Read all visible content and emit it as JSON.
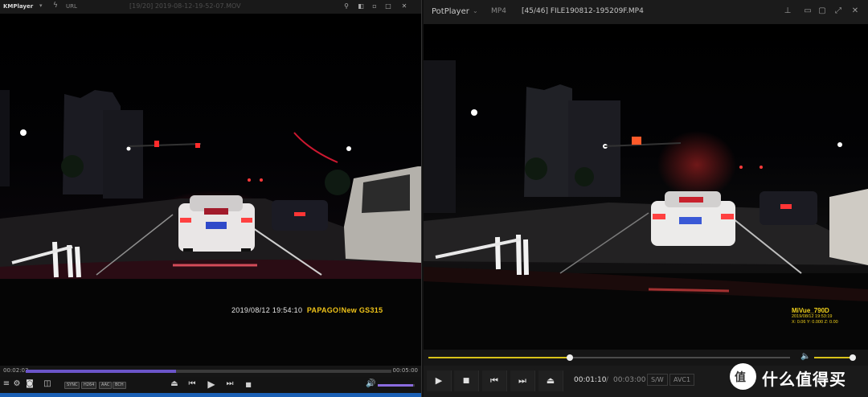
{
  "kmplayer": {
    "app_name": "KMPlayer",
    "url_label": "URL",
    "window_title": "[19/20] 2019-08-12-19-52-07.MOV",
    "osd_timestamp": "2019/08/12 19:54:10",
    "osd_brand": "PAPAGO!New GS315",
    "time_current": "00:02:03",
    "time_total": "00:05:00",
    "progress": 0.41,
    "volume": 0.95,
    "tags": [
      "SYNC",
      "H264",
      "AAC",
      "BCH"
    ],
    "icons": {
      "dropdown": "▾",
      "bolt": "ϟ",
      "pin": "⚲",
      "minimize": "▫",
      "maximize": "□",
      "close": "✕",
      "menu": "≡",
      "settings": "⚙",
      "eject": "⏏",
      "prev": "⏮",
      "play": "▶",
      "next": "⏭",
      "stop": "■",
      "volume": "🔊"
    }
  },
  "potplayer": {
    "app_name": "PotPlayer",
    "format": "MP4",
    "window_title": "[45/46] FILE190812-195209F.MP4",
    "osd_brand": "MiVue_790D",
    "osd_timestamp": "2019/08/12 19:53:19",
    "osd_gsensor": "X: 0.06  Y: 0.000 Z: 0.00",
    "time_current": "00:01:10",
    "time_separator": "/",
    "time_total": "00:03:00",
    "badge_sw": "S/W",
    "badge_codec": "AVC1",
    "progress": 0.39,
    "volume": 0.95,
    "icons": {
      "dropdown": "⌄",
      "pin": "⊥",
      "minimize": "▭",
      "restore": "▢",
      "fullscreen": "⤢",
      "close": "✕",
      "play": "▶",
      "stop": "■",
      "prev": "⏮",
      "next": "⏭",
      "eject": "⏏",
      "volume": "🔈"
    }
  },
  "watermark": {
    "glyph": "值",
    "text": "什么值得买"
  }
}
